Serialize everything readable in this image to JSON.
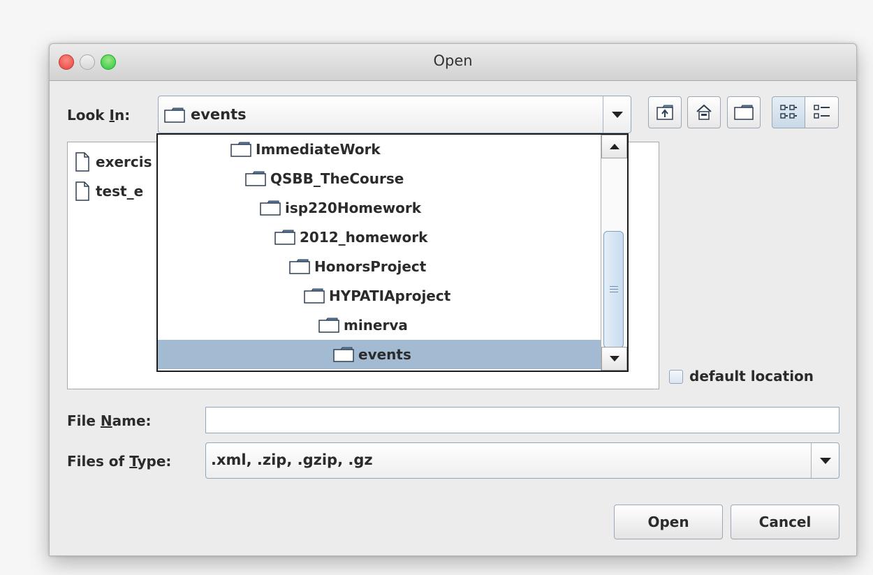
{
  "window": {
    "title": "Open"
  },
  "look_in": {
    "label_pre": "Look ",
    "label_mnemonic": "I",
    "label_post": "n:",
    "selected": "events"
  },
  "toolbar": {
    "icons": [
      "up-one-level-icon",
      "home-icon",
      "new-folder-icon",
      "list-view-icon",
      "details-view-icon"
    ]
  },
  "files": [
    {
      "name": "exercis",
      "icon": "file-icon"
    },
    {
      "name": "test_e",
      "icon": "file-icon"
    }
  ],
  "dropdown": {
    "items": [
      {
        "label": "ImmediateWork",
        "level": 0
      },
      {
        "label": "QSBB_TheCourse",
        "level": 1
      },
      {
        "label": "isp220Homework",
        "level": 2
      },
      {
        "label": "2012_homework",
        "level": 3
      },
      {
        "label": "HonorsProject",
        "level": 4
      },
      {
        "label": "HYPATIAproject",
        "level": 5
      },
      {
        "label": "minerva",
        "level": 6
      },
      {
        "label": "events",
        "level": 7,
        "selected": true
      }
    ],
    "selected_color": "#a3bbd2"
  },
  "default_location": {
    "label": "default location",
    "checked": false
  },
  "file_name": {
    "label_pre": "File ",
    "label_mnemonic": "N",
    "label_post": "ame:",
    "value": ""
  },
  "files_of_type": {
    "label_pre": "Files of ",
    "label_mnemonic": "T",
    "label_post": "ype:",
    "value": ".xml, .zip, .gzip, .gz"
  },
  "buttons": {
    "open": "Open",
    "cancel": "Cancel"
  }
}
